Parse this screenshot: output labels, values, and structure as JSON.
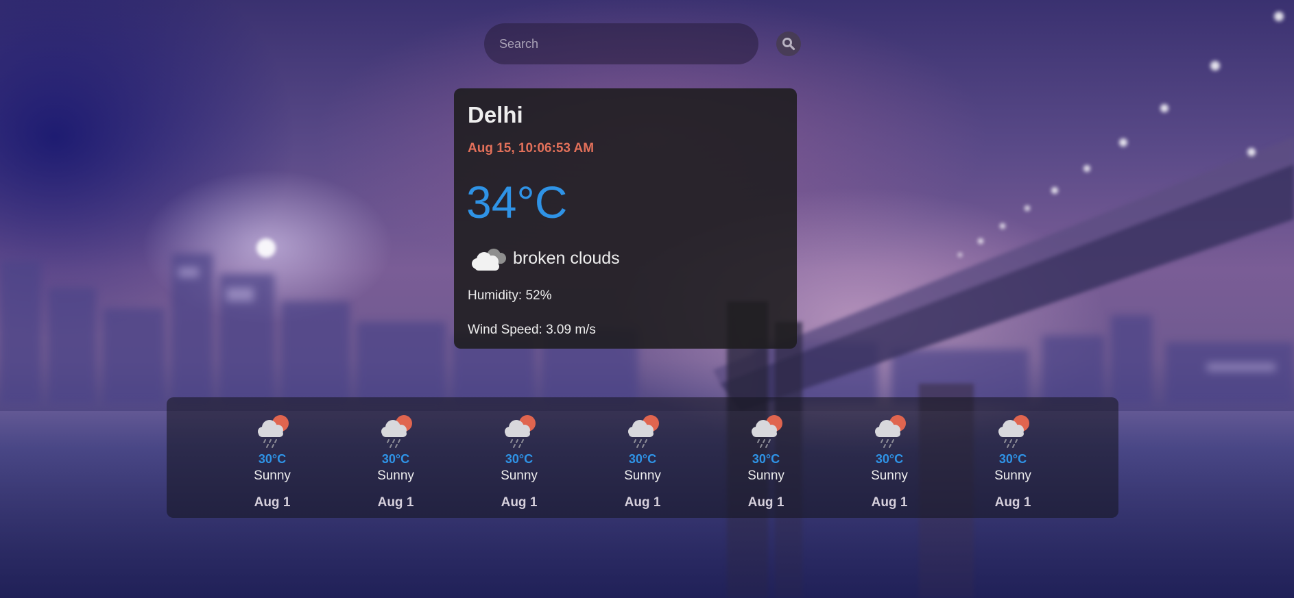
{
  "search": {
    "placeholder": "Search",
    "value": ""
  },
  "current": {
    "city": "Delhi",
    "datetime": "Aug 15, 10:06:53 AM",
    "temperature": "34°C",
    "condition": "broken clouds",
    "condition_icon": "cloud-icon",
    "humidity": "Humidity: 52%",
    "wind": "Wind Speed: 3.09 m/s"
  },
  "forecast": [
    {
      "temp": "30°C",
      "condition": "Sunny",
      "date": "Aug 1",
      "icon": "rain-sun-cloud-icon"
    },
    {
      "temp": "30°C",
      "condition": "Sunny",
      "date": "Aug 1",
      "icon": "rain-sun-cloud-icon"
    },
    {
      "temp": "30°C",
      "condition": "Sunny",
      "date": "Aug 1",
      "icon": "rain-sun-cloud-icon"
    },
    {
      "temp": "30°C",
      "condition": "Sunny",
      "date": "Aug 1",
      "icon": "rain-sun-cloud-icon"
    },
    {
      "temp": "30°C",
      "condition": "Sunny",
      "date": "Aug 1",
      "icon": "rain-sun-cloud-icon"
    },
    {
      "temp": "30°C",
      "condition": "Sunny",
      "date": "Aug 1",
      "icon": "rain-sun-cloud-icon"
    },
    {
      "temp": "30°C",
      "condition": "Sunny",
      "date": "Aug 1",
      "icon": "rain-sun-cloud-icon"
    }
  ],
  "colors": {
    "accent_blue": "#2f93e6",
    "date_orange": "#e2705a",
    "card_bg": "#1e1c1e"
  }
}
